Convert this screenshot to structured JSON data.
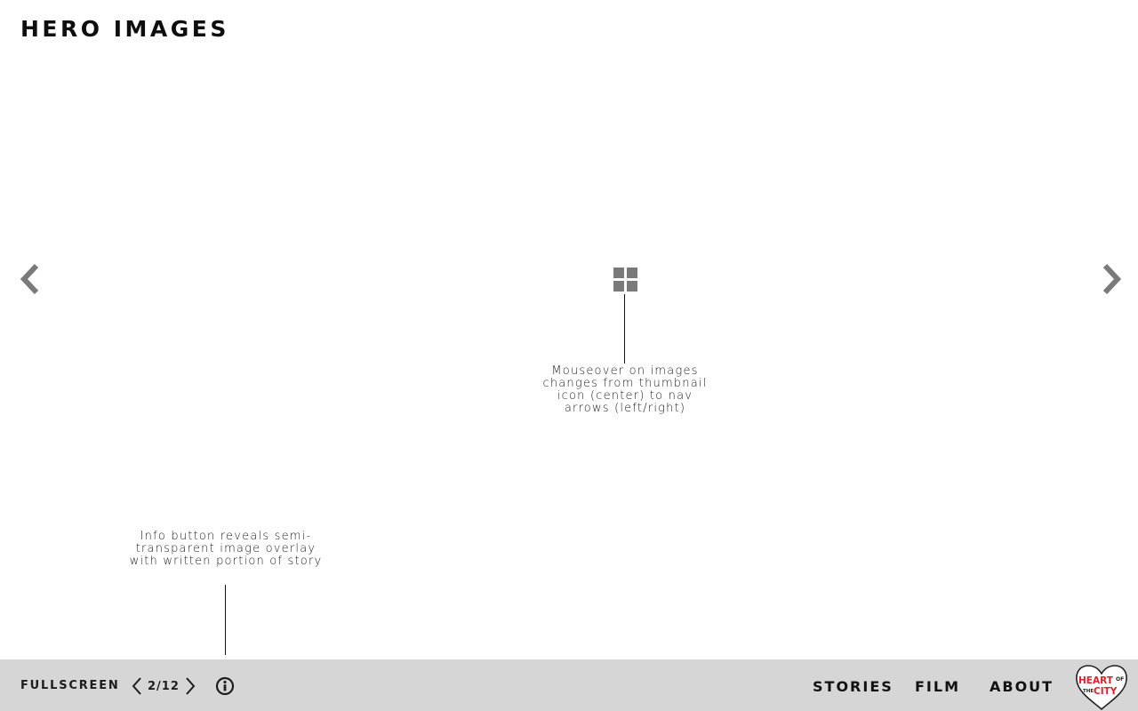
{
  "header": {
    "title": "HERO IMAGES"
  },
  "gallery": {
    "prev_icon": "chevron-left-icon",
    "next_icon": "chevron-right-icon",
    "thumbnail_icon": "grid-icon"
  },
  "annotations": {
    "center_note": "Mouseover on images changes from thumbnail icon (center) to nav arrows (left/right)",
    "info_note": "Info button reveals semi-transparent image overlay with written portion of story"
  },
  "footer": {
    "fullscreen_label": "FULLSCREEN",
    "pager_text": "2/12",
    "info_icon": "info-icon",
    "nav": {
      "stories": "STORIES",
      "film": "FILM",
      "about": "ABOUT"
    },
    "logo": {
      "line1": "HEART",
      "of": "OF",
      "the": "THE",
      "line2": "CITY"
    }
  },
  "colors": {
    "footer_bg": "#d6d6d6",
    "arrow_gray": "#7a7a7a",
    "logo_red": "#e0202a"
  }
}
